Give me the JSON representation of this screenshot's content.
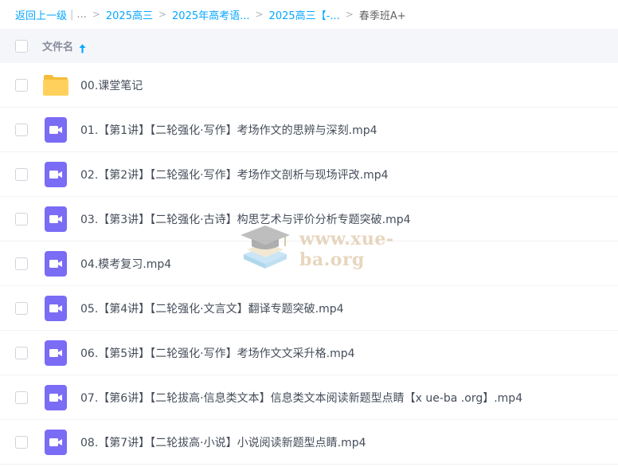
{
  "breadcrumb": {
    "back": "返回上一级",
    "pipe": "|",
    "ellipsis": "...",
    "separator": ">",
    "links": [
      "2025高三",
      "2025年高考语...",
      "2025高三【-..."
    ],
    "current": "春季班A+"
  },
  "header": {
    "name_label": "文件名",
    "sort_icon": "arrow-up-icon"
  },
  "files": [
    {
      "type": "folder",
      "icon": "folder-icon",
      "name": "00.课堂笔记"
    },
    {
      "type": "video",
      "icon": "video-file-icon",
      "name": "01.【第1讲】【二轮强化·写作】考场作文的思辨与深刻.mp4"
    },
    {
      "type": "video",
      "icon": "video-file-icon",
      "name": "02.【第2讲】【二轮强化·写作】考场作文剖析与现场评改.mp4"
    },
    {
      "type": "video",
      "icon": "video-file-icon",
      "name": "03.【第3讲】【二轮强化·古诗】构思艺术与评价分析专题突破.mp4"
    },
    {
      "type": "video",
      "icon": "video-file-icon",
      "name": "04.模考复习.mp4"
    },
    {
      "type": "video",
      "icon": "video-file-icon",
      "name": "05.【第4讲】【二轮强化·文言文】翻译专题突破.mp4"
    },
    {
      "type": "video",
      "icon": "video-file-icon",
      "name": "06.【第5讲】【二轮强化·写作】考场作文文采升格.mp4"
    },
    {
      "type": "video",
      "icon": "video-file-icon",
      "name": "07.【第6讲】【二轮拔高·信息类文本】信息类文本阅读新题型点睛【x ue-ba .org】.mp4"
    },
    {
      "type": "video",
      "icon": "video-file-icon",
      "name": "08.【第7讲】【二轮拔高·小说】小说阅读新题型点睛.mp4"
    }
  ],
  "watermark": {
    "text": "www.xue-ba.org",
    "icon": "graduation-cap-logo"
  },
  "colors": {
    "accent": "#06a7ff",
    "folder": "#ffd15c",
    "video": "#7b6cf6",
    "header_bg": "#f5f6fa",
    "text": "#454d5a"
  }
}
